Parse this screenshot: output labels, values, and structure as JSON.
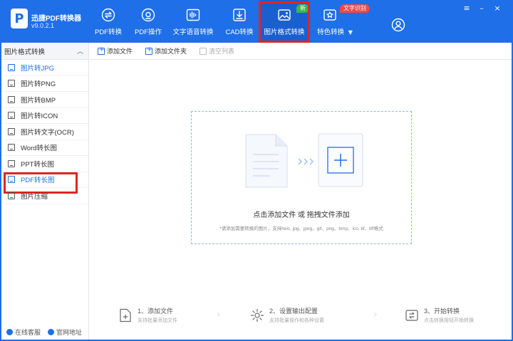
{
  "app": {
    "name": "迅捷PDF转换器",
    "version": "v9.0.2.1",
    "logo_letter": "P"
  },
  "nav": {
    "items": [
      {
        "label": "PDF转换",
        "icon": "swap-icon"
      },
      {
        "label": "PDF操作",
        "icon": "gear-doc-icon"
      },
      {
        "label": "文字语音转换",
        "icon": "waveform-icon"
      },
      {
        "label": "CAD转换",
        "icon": "cad-download-icon"
      },
      {
        "label": "图片格式转换",
        "icon": "image-icon",
        "badge": "新",
        "active": true
      },
      {
        "label": "特色转换",
        "icon": "star-box-icon",
        "badge": "文字识别",
        "dropdown": true
      }
    ],
    "user_icon": "user-icon",
    "colors": {
      "bar": "#1e6fe8",
      "badge_new": "#3fb54a",
      "badge_ocr": "#f04848",
      "highlight": "#e02424"
    }
  },
  "window_controls": [
    "≡",
    "–",
    "×"
  ],
  "sidebar": {
    "title": "图片格式转换",
    "items": [
      {
        "label": "图片转JPG",
        "state": "active"
      },
      {
        "label": "图片转PNG"
      },
      {
        "label": "图片转BMP"
      },
      {
        "label": "图片转ICON"
      },
      {
        "label": "图片转文字(OCR)"
      },
      {
        "label": "Word转长图"
      },
      {
        "label": "PPT转长图"
      },
      {
        "label": "PDF转长图",
        "state": "selected"
      },
      {
        "label": "图片压缩"
      }
    ],
    "footer": {
      "support": "在线客服",
      "website": "官网地址"
    }
  },
  "toolbar": {
    "add_file": "添加文件",
    "add_folder": "添加文件夹",
    "clear_list": "清空列表"
  },
  "dropzone": {
    "title": "点击添加文件 或 拖拽文件添加",
    "subtitle": "*请添加需要转换的图片，支持heic, jpg、jpeg、gif、png、bmp、ico, tif、tiff格式"
  },
  "steps": [
    {
      "title": "1、添加文件",
      "desc": "支持批量添加文件"
    },
    {
      "title": "2、设置输出配置",
      "desc": "支持批量操作和各种设置"
    },
    {
      "title": "3、开始转换",
      "desc": "点击转换按钮开始转换"
    }
  ]
}
